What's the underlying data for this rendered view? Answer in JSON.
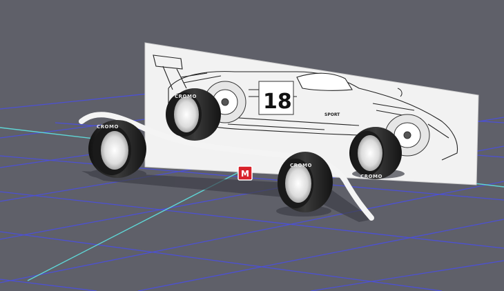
{
  "scene": {
    "background": "#5f6069",
    "grid_color": "#4a4fe0",
    "axis_x_color": "#5fd6d6",
    "axis_z_color": "#5fd6d6"
  },
  "blueprint": {
    "car_number": "18",
    "sponsor_text": "SPORT"
  },
  "tires": {
    "brand": "CROMO"
  },
  "gizmo": {
    "label": "M",
    "color": "#d8222a"
  }
}
